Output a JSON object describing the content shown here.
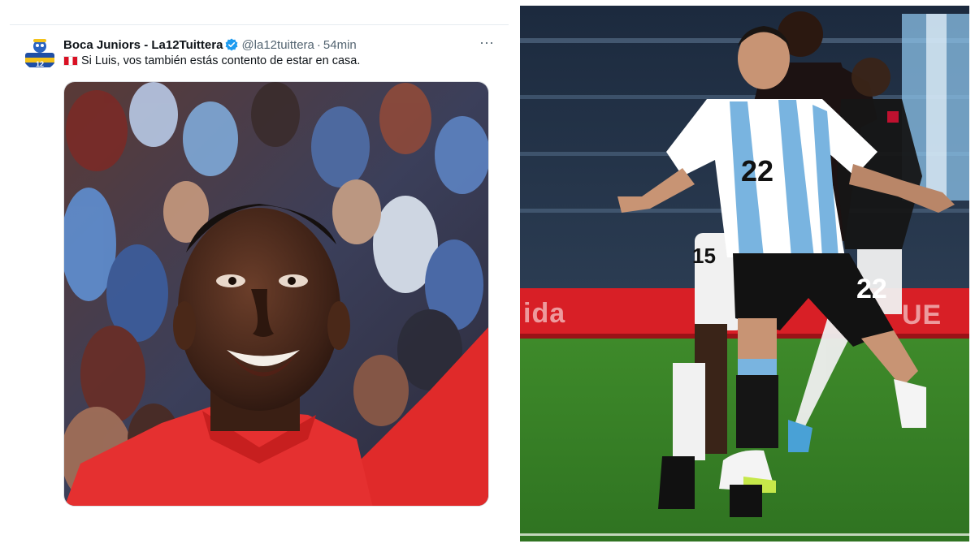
{
  "tweet": {
    "author_name": "Boca Juniors - La12Tuittera",
    "handle": "@la12tuittera",
    "separator": "·",
    "time": "54min",
    "more_label": "···",
    "flag_icon": "peru-flag-icon",
    "text": "Si Luis, vos también estás contento de estar en casa.",
    "colors": {
      "verified": "#1d9bf0",
      "peru_red": "#d91023"
    }
  },
  "photo": {
    "front_player_number": "22",
    "back_player_number": "15",
    "ad_left": "ida",
    "ad_right": "UE",
    "colors": {
      "pitch": "#3f8a2c",
      "ad_board": "#d81f26",
      "argentina_blue": "#79b4e0",
      "peru_red": "#c8102e"
    }
  }
}
